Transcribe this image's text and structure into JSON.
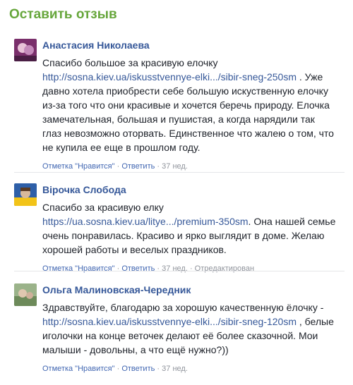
{
  "page_title": "Оставить отзыв",
  "comments": [
    {
      "author": "Анастасия Николаева",
      "parts": {
        "p1": "Спасибо большое за красивую елочку ",
        "link": "http://sosna.kiev.ua/iskusstvennye-elki.../sibir-sneg-250sm",
        "p2": " . Уже давно хотела приобрести себе большую искуственную елочку из-за того что они красивые и хочется беречь природу. Елочка замечательная, большая и пушистая, а когда нарядили так глаз невозможно оторвать. Единственное что жалею о том, что не купила ее еще в прошлом году."
      },
      "like_label": "Отметка \"Нравится\"",
      "reply_label": "Ответить",
      "time": "37 нед."
    },
    {
      "author": "Вірочка Слобода",
      "parts": {
        "p1": "Спасибо за красивую елку ",
        "link": "https://ua.sosna.kiev.ua/litye.../premium-350sm",
        "p2": ". Она нашей семье очень понравилась. Красиво и ярко выглядит в доме. Желаю хорошей работы и веселых праздников."
      },
      "like_label": "Отметка \"Нравится\"",
      "reply_label": "Ответить",
      "time": "37 нед.",
      "edited": "Отредактирован"
    },
    {
      "author": "Ольга Малиновская-Чередник",
      "parts": {
        "p1": "Здравствуйте, благодарю за хорошую качественную ёлочку - ",
        "link": "http://sosna.kiev.ua/iskusstvennye-elki.../sibir-sneg-120sm",
        "p2": " , белые иголочки на конце веточек делают её более сказочной. Мои малыши - довольны, а что ещё нужно?))"
      },
      "like_label": "Отметка \"Нравится\"",
      "reply_label": "Ответить",
      "time": "37 нед."
    }
  ],
  "separator": "·"
}
